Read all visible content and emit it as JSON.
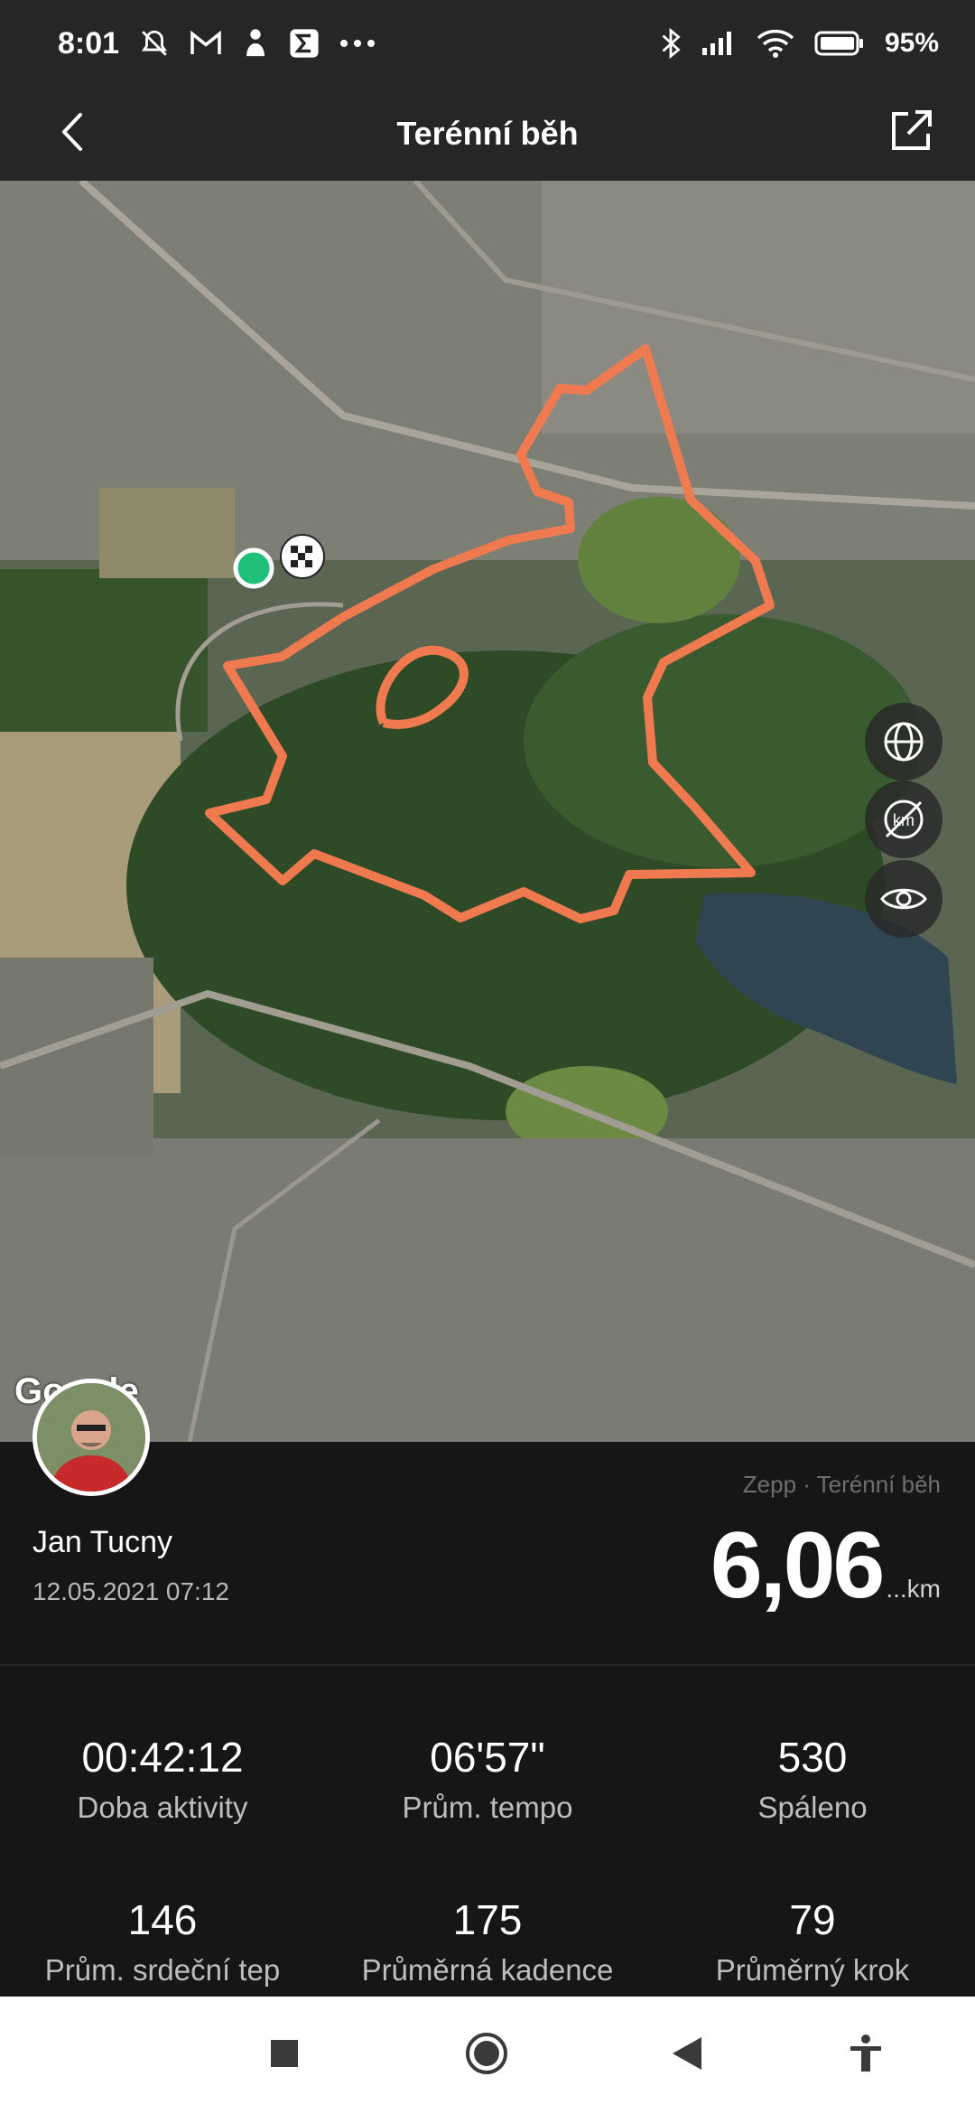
{
  "status_bar": {
    "time": "8:01",
    "battery": "95%",
    "left_icons": [
      "mute-icon",
      "gmail-icon",
      "notification-icon",
      "sigma-icon",
      "more-icon"
    ],
    "right_icons": [
      "bluetooth-icon",
      "signal-icon",
      "wifi-icon",
      "battery-icon"
    ]
  },
  "header": {
    "title": "Terénní běh",
    "back_icon": "chevron-left-icon",
    "share_icon": "share-icon"
  },
  "map": {
    "attribution": "Google",
    "route_color": "#F07A50",
    "start_marker_color": "#21C07A",
    "finish_marker_icon": "checkered-flag-icon",
    "controls": [
      "globe-icon",
      "km-marker-off-icon",
      "eye-icon"
    ]
  },
  "activity": {
    "user_name": "Jan Tucny",
    "date": "12.05.2021 07:12",
    "source": "Zepp · Terénní běh",
    "distance_value": "6,06",
    "distance_unit": "...km"
  },
  "stats": [
    {
      "value": "00:42:12",
      "label": "Doba aktivity"
    },
    {
      "value": "06'57\"",
      "label": "Prům. tempo"
    },
    {
      "value": "530",
      "label": "Spáleno"
    },
    {
      "value": "146",
      "label": "Prům. srdeční tep"
    },
    {
      "value": "175",
      "label": "Průměrná kadence"
    },
    {
      "value": "79",
      "label": "Průměrný krok"
    }
  ],
  "nav_bar": {
    "icons": [
      "recents-square-icon",
      "home-circle-icon",
      "back-triangle-icon",
      "accessibility-icon"
    ]
  }
}
